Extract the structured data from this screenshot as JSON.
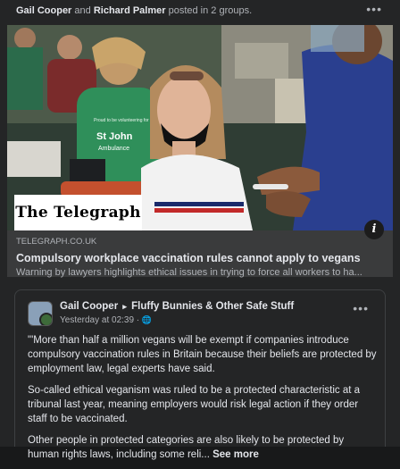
{
  "header": {
    "author1": "Gail Cooper",
    "and": "and",
    "author2": "Richard Palmer",
    "suffix": "posted in 2 groups.",
    "more": "•••"
  },
  "link": {
    "logo_text": "The Telegraph",
    "info": "i",
    "domain": "TELEGRAPH.CO.UK",
    "title": "Compulsory workplace vaccination rules cannot apply to vegans",
    "description": "Warning by lawyers highlights ethical issues in trying to force all workers to ha...",
    "photo_shirt_text": "St John Ambulance",
    "photo_shirt_small": "Proud to be volunteering for"
  },
  "shared_post": {
    "author": "Gail Cooper",
    "arrow": "▸",
    "group": "Fluffy Bunnies & Other Safe Stuff",
    "time": "Yesterday at 02:39 · ",
    "globe": "🌐",
    "more": "•••",
    "paragraphs": [
      "\"'More than half a million vegans will be exempt if companies introduce compulsory vaccination rules in Britain because their beliefs are protected by employment law, legal experts have said.",
      "So-called ethical veganism was ruled to be a protected characteristic at a tribunal last year, meaning employers would risk legal action if they order staff to be vaccinated.",
      "Other people in protected categories are also likely to be protected by human rights laws, including some reli... "
    ],
    "see_more": "See more"
  },
  "colors": {
    "background": "#242526",
    "text_primary": "#e4e6eb",
    "text_secondary": "#b0b3b8",
    "link_bg": "#3a3b3c"
  }
}
